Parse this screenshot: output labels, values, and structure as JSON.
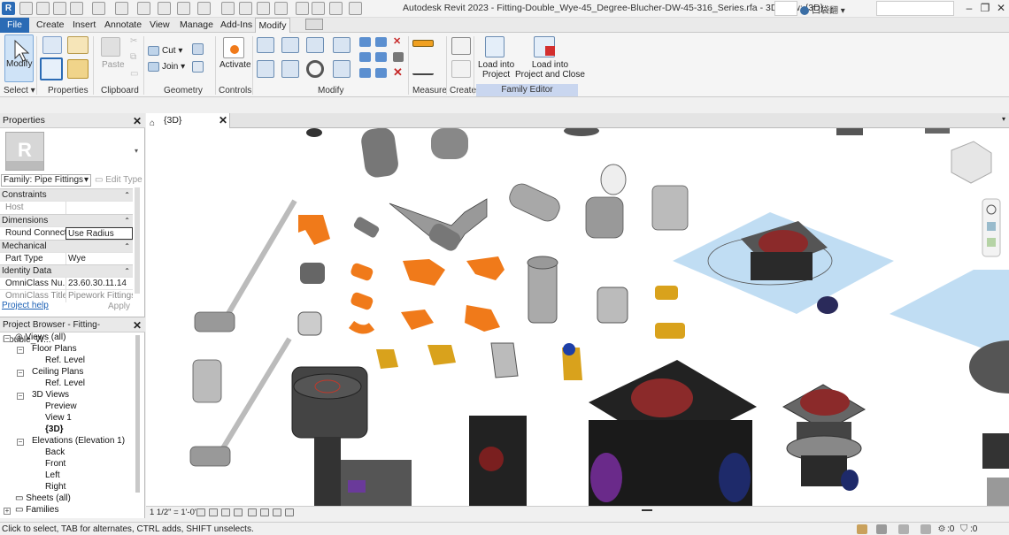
{
  "window": {
    "title": "Autodesk Revit 2023 - Fitting-Double_Wye-45_Degree-Blucher-DW-45-316_Series.rfa - 3D View: {3D}",
    "user": "口袋翻"
  },
  "menu": {
    "tabs": [
      "File",
      "Create",
      "Insert",
      "Annotate",
      "View",
      "Manage",
      "Add-Ins",
      "Modify"
    ],
    "active": "Modify"
  },
  "ribbon": {
    "modify_label": "Modify",
    "paste_label": "Paste",
    "cut_label": "Cut",
    "join_label": "Join",
    "activate_label": "Activate",
    "load_into_project": "Load into\nProject",
    "load_into_project_close": "Load into\nProject and Close",
    "groups": {
      "select": "Select",
      "properties": "Properties",
      "clipboard": "Clipboard",
      "geometry": "Geometry",
      "controls": "Controls",
      "modify": "Modify",
      "measure": "Measure",
      "create": "Create",
      "family_editor": "Family Editor"
    }
  },
  "properties": {
    "title": "Properties",
    "family_select": "Family: Pipe Fittings",
    "edit_type": "Edit Type",
    "categories": {
      "constraints": "Constraints",
      "dimensions": "Dimensions",
      "mechanical": "Mechanical",
      "identity": "Identity Data"
    },
    "rows": {
      "host": {
        "name": "Host",
        "value": ""
      },
      "round_connect": {
        "name": "Round Connect...",
        "value": "Use Radius"
      },
      "part_type": {
        "name": "Part Type",
        "value": "Wye"
      },
      "omniclass_num": {
        "name": "OmniClass Nu...",
        "value": "23.60.30.11.14"
      },
      "omniclass_title": {
        "name": "OmniClass Title",
        "value": "Pipework Fittings"
      }
    },
    "help_link": "Project help",
    "apply": "Apply"
  },
  "browser": {
    "title": "Project Browser - Fitting-Double_W...",
    "views_all": "Views (all)",
    "floor_plans": "Floor Plans",
    "ref_level_1": "Ref. Level",
    "ceiling_plans": "Ceiling Plans",
    "ref_level_2": "Ref. Level",
    "views_3d": "3D Views",
    "preview": "Preview",
    "view1": "View 1",
    "view_3d": "{3D}",
    "elevations": "Elevations (Elevation 1)",
    "back": "Back",
    "front": "Front",
    "left": "Left",
    "right": "Right",
    "sheets": "Sheets (all)",
    "families": "Families"
  },
  "view": {
    "tab_label": "{3D}",
    "scale": "1 1/2\" = 1'-0\""
  },
  "status": {
    "text": "Click to select, TAB for alternates, CTRL adds, SHIFT unselects.",
    "count1": ":0",
    "count2": ":0"
  },
  "colors": {
    "accent": "#2b6bb5",
    "orange_fitting": "#f07a1a",
    "brass": "#d9a21c",
    "dark_fixture": "#2a2a2a",
    "red_grate": "#8b2a2a",
    "blue_plane": "#b9d9f2"
  }
}
